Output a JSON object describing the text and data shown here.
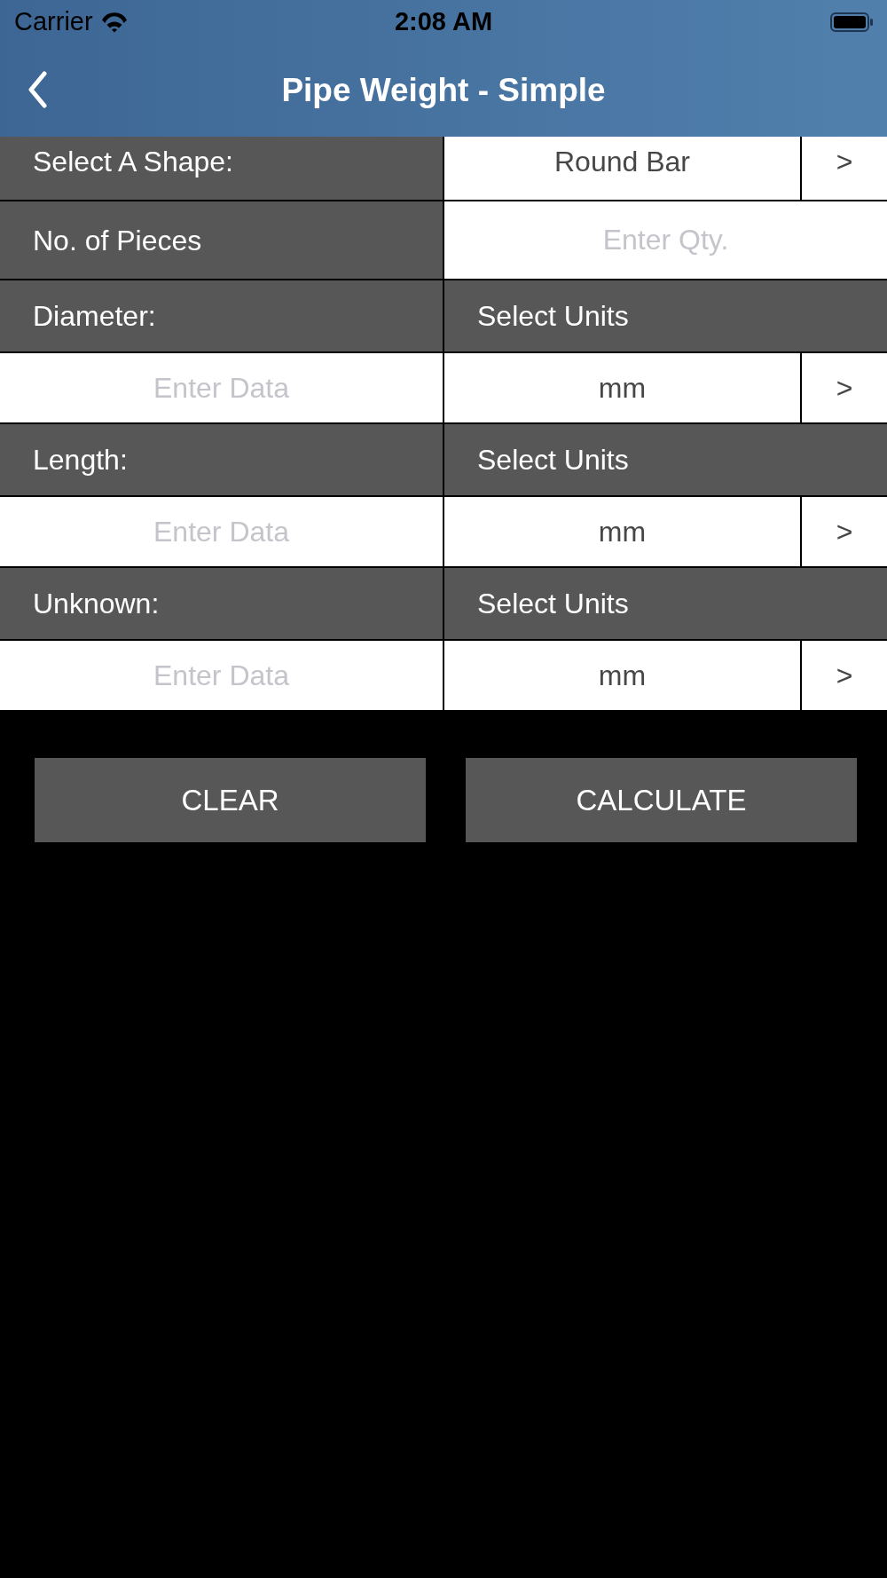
{
  "status_bar": {
    "carrier": "Carrier",
    "time": "2:08 AM"
  },
  "nav_bar": {
    "title": "Pipe Weight - Simple"
  },
  "form_rows": [
    {
      "kind": "picker",
      "label": "Select A Shape:",
      "value": "Round Bar",
      "chevron": ">"
    },
    {
      "kind": "quantity",
      "label": "No. of Pieces",
      "placeholder": "Enter Qty."
    },
    {
      "kind": "measurement",
      "label": "Diameter:",
      "units_label": "Select Units",
      "placeholder": "Enter Data",
      "unit": "mm",
      "chevron": ">"
    },
    {
      "kind": "measurement",
      "label": "Length:",
      "units_label": "Select Units",
      "placeholder": "Enter Data",
      "unit": "mm",
      "chevron": ">"
    },
    {
      "kind": "measurement",
      "label": "Unknown:",
      "units_label": "Select Units",
      "placeholder": "Enter Data",
      "unit": "mm",
      "chevron": ">"
    }
  ],
  "buttons": [
    "CLEAR",
    "CALCULATE"
  ]
}
